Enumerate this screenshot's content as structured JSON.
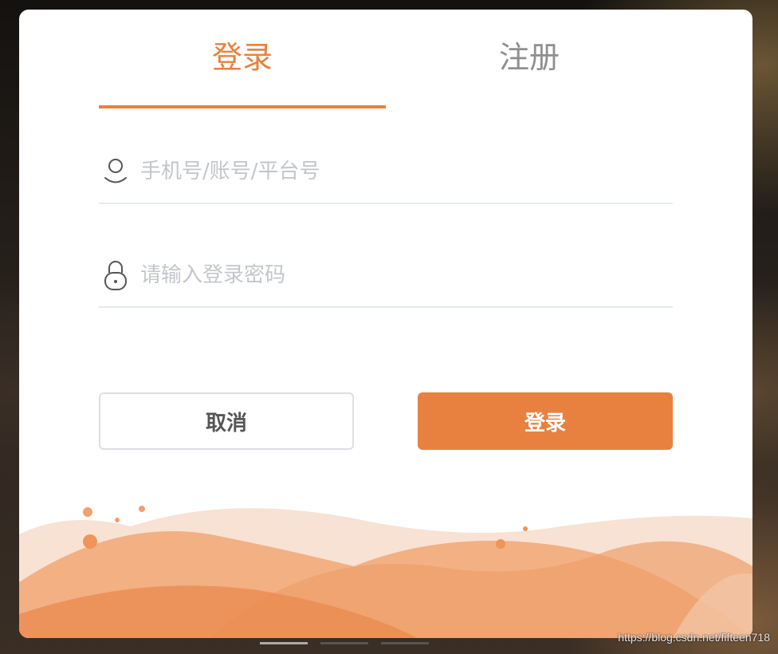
{
  "tabs": {
    "login_label": "登录",
    "register_label": "注册",
    "active_color": "#e8813f",
    "inactive_color": "#8f8f8f"
  },
  "form": {
    "account_placeholder": "手机号/账号/平台号",
    "password_placeholder": "请输入登录密码",
    "account_icon": "user-icon",
    "password_icon": "lock-icon"
  },
  "buttons": {
    "cancel_label": "取消",
    "submit_label": "登录",
    "submit_color": "#e8813f"
  },
  "watermark": "https://blog.csdn.net/fifteen718"
}
